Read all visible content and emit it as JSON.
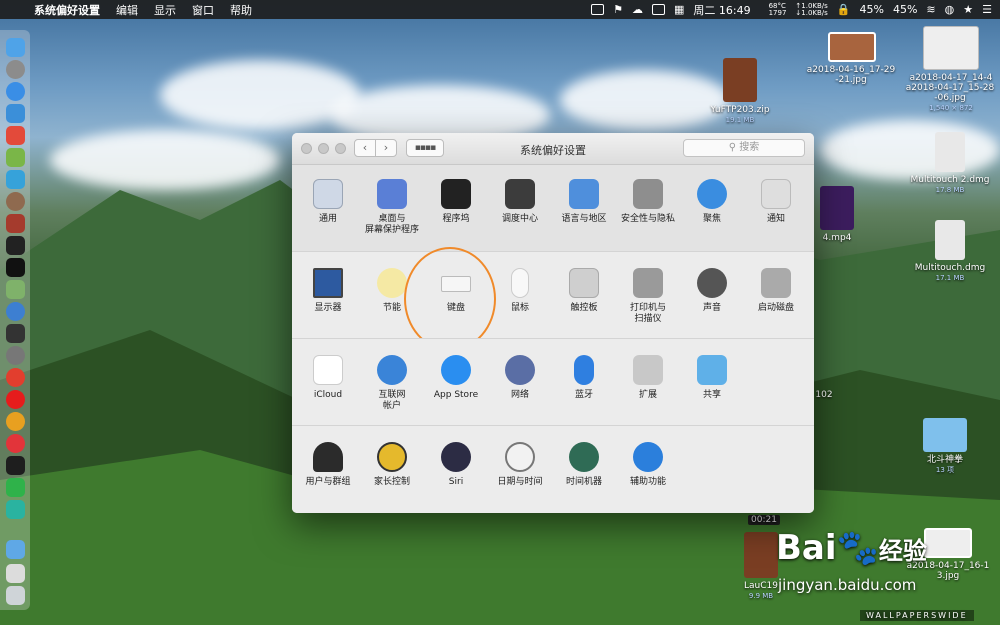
{
  "menubar": {
    "app_name": "系统偏好设置",
    "items": [
      "编辑",
      "显示",
      "窗口",
      "帮助"
    ],
    "temp": "68°C",
    "rpm": "1797",
    "net_up": "↑1.0KB/s",
    "net_down": "↓1.0KB/s",
    "datetime": "周二 16:49",
    "cpu": "45%",
    "battery": "45%"
  },
  "window": {
    "title": "系统偏好设置",
    "search_placeholder": "搜索",
    "rows": [
      [
        "通用",
        "桌面与\n屏幕保护程序",
        "程序坞",
        "调度中心",
        "语言与地区",
        "安全性与隐私",
        "聚焦",
        "通知"
      ],
      [
        "显示器",
        "节能",
        "键盘",
        "鼠标",
        "触控板",
        "打印机与\n扫描仪",
        "声音",
        "启动磁盘"
      ],
      [
        "iCloud",
        "互联网\n帐户",
        "App Store",
        "网络",
        "蓝牙",
        "扩展",
        "共享"
      ],
      [
        "用户与群组",
        "家长控制",
        "Siri",
        "日期与时间",
        "时间机器",
        "辅助功能"
      ]
    ]
  },
  "desktop": {
    "files": [
      {
        "name": "YuFTP203.zip",
        "sub": "19.1 MB"
      },
      {
        "name": "a2018-04-16_17-29-21.jpg",
        "sub": ""
      },
      {
        "name": "a2018-04-17_14-4",
        "sub": ""
      },
      {
        "name": "a2018-04-17_15-28-06.jpg",
        "sub": "1,540 × 872"
      },
      {
        "name": "Multitouch 2.dmg",
        "sub": "17.8 MB"
      },
      {
        "name": "4.mp4",
        "sub": ""
      },
      {
        "name": "Multitouch.dmg",
        "sub": "17.1 MB"
      },
      {
        "name": "北斗神拳",
        "sub": "13 项"
      },
      {
        "name": "LauC19",
        "sub": "9.9 MB"
      },
      {
        "name": "a2018-04-17_16-1",
        "sub": "3.jpg"
      }
    ],
    "fragment_102": "102",
    "time_label": "00:21"
  },
  "watermark": {
    "brand": "Bai",
    "brand2": "经验",
    "site": "jingyan.baidu.com",
    "footer": "WALLPAPERSWIDE"
  }
}
